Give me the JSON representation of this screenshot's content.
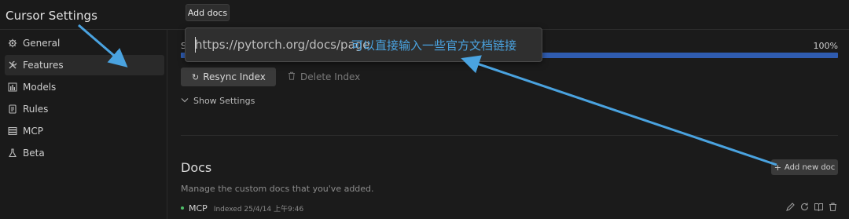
{
  "app": {
    "title": "Cursor Settings"
  },
  "sidebar": {
    "items": [
      {
        "label": "General",
        "icon": "gear-icon"
      },
      {
        "label": "Features",
        "icon": "tools-icon",
        "active": true
      },
      {
        "label": "Models",
        "icon": "bar-chart-icon"
      },
      {
        "label": "Rules",
        "icon": "file-icon"
      },
      {
        "label": "MCP",
        "icon": "server-icon"
      },
      {
        "label": "Beta",
        "icon": "flask-icon"
      }
    ]
  },
  "tooltip": {
    "text": "Add docs"
  },
  "url_popup": {
    "value": "https://pytorch.org/docs/page",
    "annotation": "可以直接输入一些官方文档链接",
    "annotation_color": "#4aa3e0"
  },
  "indexing": {
    "prefix": "S",
    "progress_label": "100%",
    "progress_value": 1.0,
    "bar_color": "#2f5cb0",
    "resync_label": "Resync Index",
    "delete_label": "Delete Index",
    "show_settings_label": "Show Settings"
  },
  "docs": {
    "title": "Docs",
    "description": "Manage the custom docs that you've added.",
    "add_button_label": "Add new doc",
    "items": [
      {
        "name": "MCP",
        "status": "Indexed 25/4/14 上午9:46",
        "status_color": "#4fbf6a"
      }
    ]
  }
}
